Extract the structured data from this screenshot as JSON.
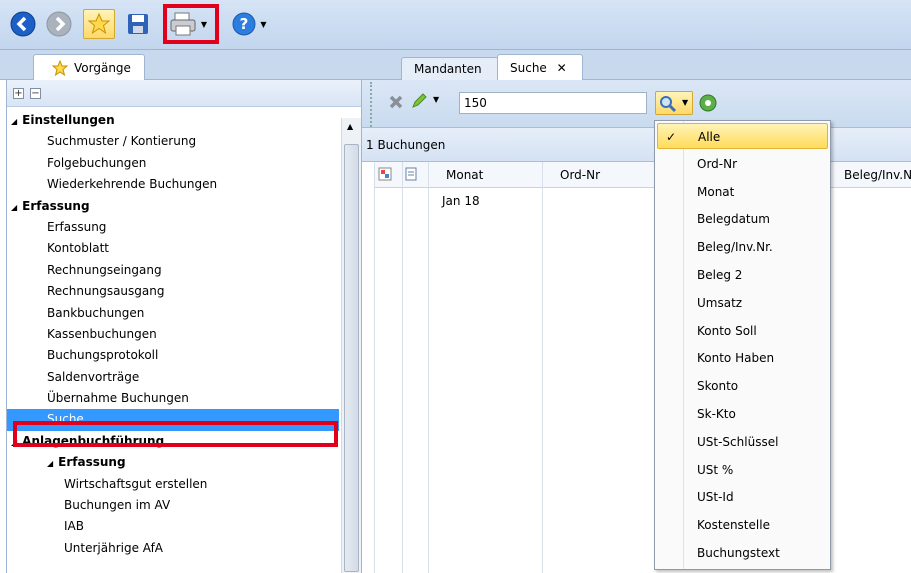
{
  "toolbar": {
    "icons": [
      "back-icon",
      "forward-icon",
      "star-icon",
      "save-icon",
      "print-icon",
      "help-icon"
    ],
    "colors": {
      "accent": "#3399ff",
      "highlight": "#e0001b"
    }
  },
  "left_tab": {
    "label": "Vorgänge"
  },
  "right_tabs": [
    {
      "label": "Mandanten"
    },
    {
      "label": "Suche",
      "close": "✕"
    }
  ],
  "tree": {
    "items": [
      {
        "label": "Einstellungen",
        "level": 0,
        "bold": true,
        "expanded": true
      },
      {
        "label": "Suchmuster / Kontierung",
        "level": 1
      },
      {
        "label": "Folgebuchungen",
        "level": 1
      },
      {
        "label": "Wiederkehrende Buchungen",
        "level": 1
      },
      {
        "label": "Erfassung",
        "level": 0,
        "bold": true,
        "expanded": true
      },
      {
        "label": "Erfassung",
        "level": 1
      },
      {
        "label": "Kontoblatt",
        "level": 1
      },
      {
        "label": "Rechnungseingang",
        "level": 1
      },
      {
        "label": "Rechnungsausgang",
        "level": 1
      },
      {
        "label": "Bankbuchungen",
        "level": 1
      },
      {
        "label": "Kassenbuchungen",
        "level": 1
      },
      {
        "label": "Buchungsprotokoll",
        "level": 1
      },
      {
        "label": "Saldenvorträge",
        "level": 1
      },
      {
        "label": "Übernahme Buchungen",
        "level": 1
      },
      {
        "label": "Suche",
        "level": 1,
        "selected": true
      },
      {
        "label": "Anlagenbuchführung",
        "level": 0,
        "bold": true,
        "expanded": true
      },
      {
        "label": "Erfassung",
        "level": 1,
        "bold": true,
        "expanded": true
      },
      {
        "label": "Wirtschaftsgut erstellen",
        "level": 2
      },
      {
        "label": "Buchungen im AV",
        "level": 2
      },
      {
        "label": "IAB",
        "level": 2
      },
      {
        "label": "Unterjährige AfA",
        "level": 2
      }
    ]
  },
  "search": {
    "value": "150"
  },
  "results": {
    "count_label": "1 Buchungen"
  },
  "grid": {
    "columns": [
      "Monat",
      "Ord-Nr",
      "Beleg/Inv.Nr."
    ],
    "rows": [
      {
        "Monat": "Jan 18"
      }
    ]
  },
  "dropdown": {
    "check": "✓",
    "items": [
      "Alle",
      "Ord-Nr",
      "Monat",
      "Belegdatum",
      "Beleg/Inv.Nr.",
      "Beleg 2",
      "Umsatz",
      "Konto Soll",
      "Konto Haben",
      "Skonto",
      "Sk-Kto",
      "USt-Schlüssel",
      "USt %",
      "USt-Id",
      "Kostenstelle",
      "Buchungstext"
    ],
    "selected": "Alle"
  }
}
